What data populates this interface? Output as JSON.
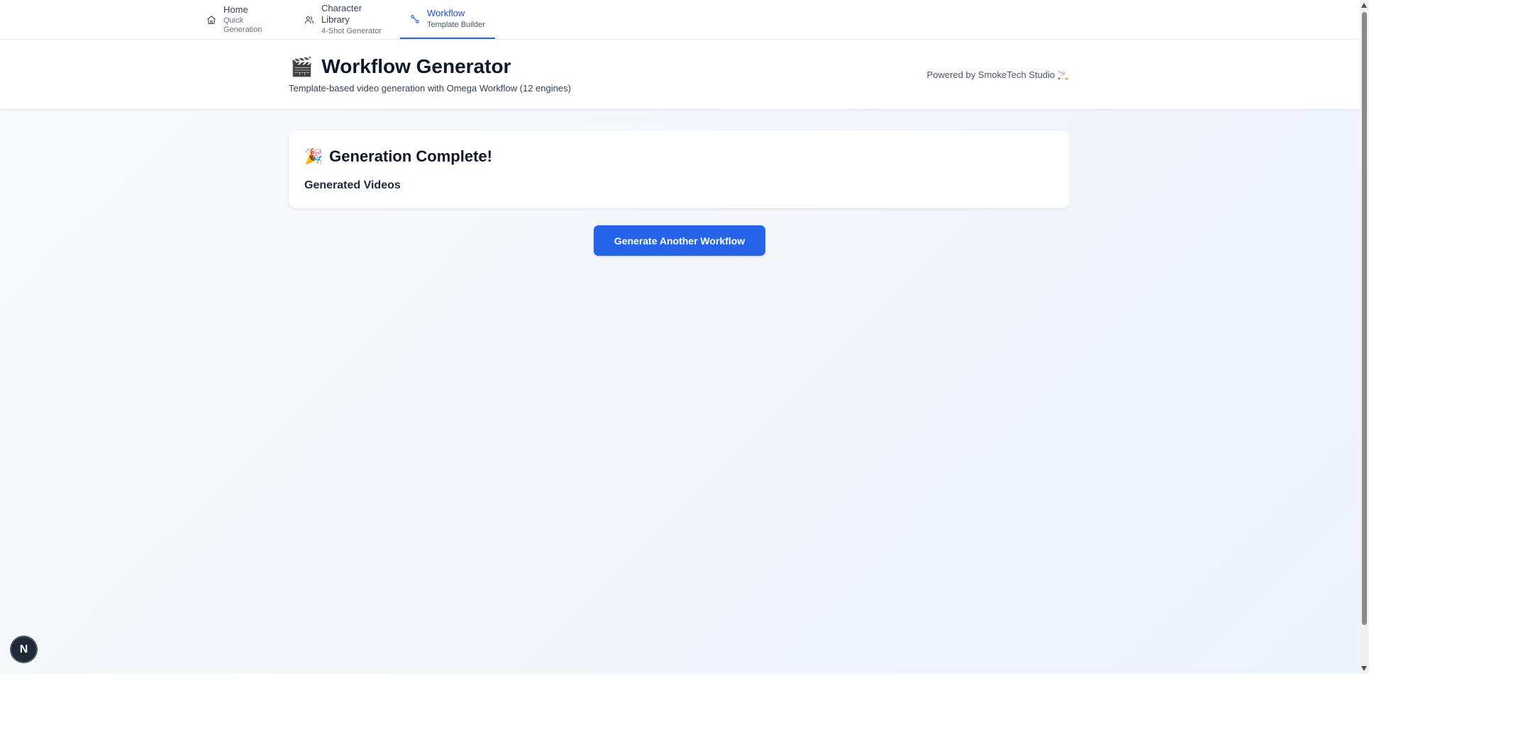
{
  "nav": {
    "items": [
      {
        "label": "Home",
        "sub": "Quick Generation",
        "icon": "home-icon",
        "active": false
      },
      {
        "label": "Character Library",
        "sub": "4-Shot Generator",
        "icon": "users-icon",
        "active": false
      },
      {
        "label": "Workflow",
        "sub": "Template Builder",
        "icon": "workflow-icon",
        "active": true
      }
    ]
  },
  "header": {
    "emoji": "🎬",
    "title": "Workflow Generator",
    "subtitle": "Template-based video generation with Omega Workflow (12 engines)",
    "powered_by": "Powered by SmokeTech Studio 🚬"
  },
  "result": {
    "emoji": "🎉",
    "title": "Generation Complete!",
    "section_label": "Generated Videos"
  },
  "actions": {
    "generate_another_label": "Generate Another Workflow"
  },
  "dev_badge": {
    "label": "N"
  },
  "colors": {
    "accent": "#2563eb",
    "active_nav": "#1d4ed8",
    "background": "#f3f6fb"
  }
}
